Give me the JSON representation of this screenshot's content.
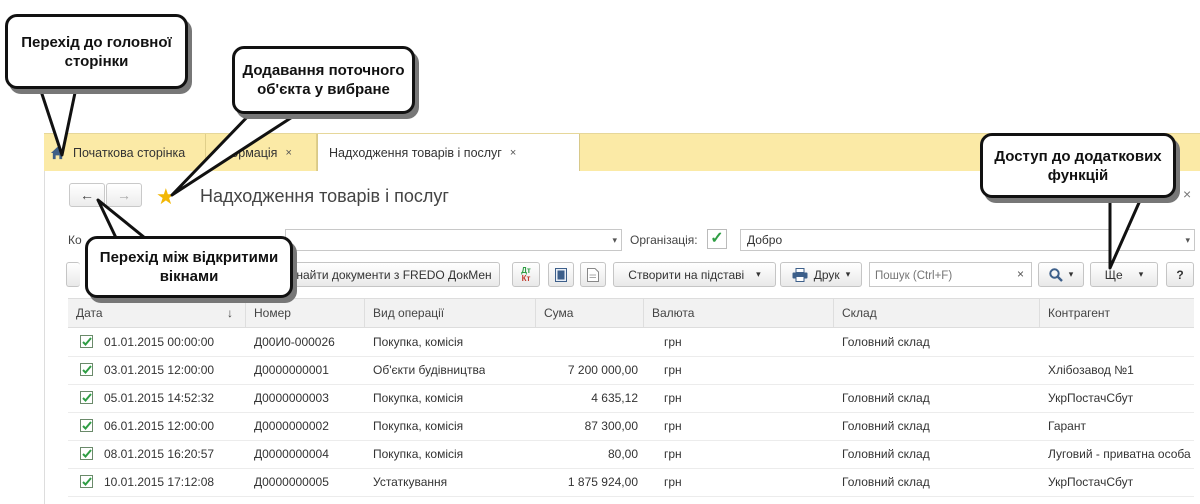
{
  "tabs": {
    "home_label": "Початкова сторінка",
    "info_label": "формація",
    "active_label": "Надходження товарів і послуг",
    "close_symbol": "×"
  },
  "form": {
    "title": "Надходження товарів і послуг",
    "close_symbol": "×",
    "back_symbol": "←",
    "forward_symbol": "→",
    "favorite_symbol": "★",
    "kontragent_label_partial": "Ко",
    "organization_label": "Організація:",
    "organization_value": "Добро",
    "organization_checkbox": "✓"
  },
  "toolbar": {
    "find_docs_label": "найти документи з FREDO ДокМен",
    "dt_kt_label_top": "Дт",
    "dt_kt_label_bottom": "Кт",
    "create_based_label": "Створити на підставі",
    "print_label": "Друк",
    "search_placeholder": "Пошук (Ctrl+F)",
    "search_clear": "×",
    "more_label": "Ще",
    "help_label": "?",
    "dropdown_symbol": "▾"
  },
  "table": {
    "columns": [
      "Дата",
      "Номер",
      "Вид операції",
      "Сума",
      "Валюта",
      "Склад",
      "Контрагент"
    ],
    "sort_indicator": "↓",
    "rows": [
      {
        "date": "01.01.2015 00:00:00",
        "number": "Д00И0-000026",
        "operation": "Покупка, комісія",
        "sum": "",
        "currency": "грн",
        "warehouse": "Головний склад",
        "counterparty": ""
      },
      {
        "date": "03.01.2015 12:00:00",
        "number": "Д0000000001",
        "operation": "Об'єкти будівництва",
        "sum": "7 200 000,00",
        "currency": "грн",
        "warehouse": "",
        "counterparty": "Хлібозавод №1"
      },
      {
        "date": "05.01.2015 14:52:32",
        "number": "Д0000000003",
        "operation": "Покупка, комісія",
        "sum": "4 635,12",
        "currency": "грн",
        "warehouse": "Головний склад",
        "counterparty": "УкрПостачСбут"
      },
      {
        "date": "06.01.2015 12:00:00",
        "number": "Д0000000002",
        "operation": "Покупка, комісія",
        "sum": "87 300,00",
        "currency": "грн",
        "warehouse": "Головний склад",
        "counterparty": "Гарант"
      },
      {
        "date": "08.01.2015 16:20:57",
        "number": "Д0000000004",
        "operation": "Покупка, комісія",
        "sum": "80,00",
        "currency": "грн",
        "warehouse": "Головний склад",
        "counterparty": "Луговий - приватна особа"
      },
      {
        "date": "10.01.2015 17:12:08",
        "number": "Д0000000005",
        "operation": "Устаткування",
        "sum": "1 875 924,00",
        "currency": "грн",
        "warehouse": "Головний склад",
        "counterparty": "УкрПостачСбут"
      }
    ]
  },
  "callouts": {
    "home": "Перехід до головної сторінки",
    "favorite": "Додавання поточного об'єкта у вибране",
    "windows": "Перехід між відкритими вікнами",
    "more": "Доступ до додаткових функцій"
  },
  "colors": {
    "tab_strip": "#fbeaa6",
    "accent_green": "#2f9e44",
    "star": "#f2b705"
  }
}
